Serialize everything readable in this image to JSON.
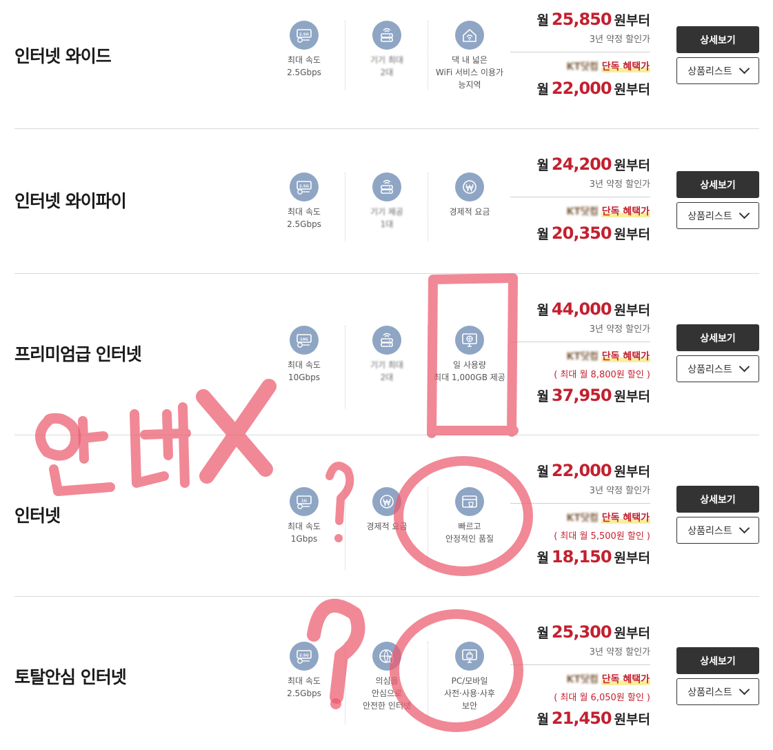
{
  "products": [
    {
      "title": "인터넷 와이드",
      "features": [
        {
          "icon": "speed-2.5g-icon",
          "label": "최대 속도\n2.5Gbps",
          "blur": false
        },
        {
          "icon": "router-icon",
          "label": "기기 최대\n2대",
          "blur": true
        },
        {
          "icon": "home-wifi-icon",
          "label": "댁 내 넓은\nWiFi 서비스 이용가\n능지역",
          "blur": false
        }
      ],
      "price_prefix": "월",
      "price": "25,850",
      "price_suffix": "원부터",
      "contract_note": "3년 약정 할인가",
      "exclusive_brand": "KT닷컴",
      "exclusive_label": "단독 혜택가",
      "discount_note": "",
      "exclusive_price": "22,000",
      "detail_button": "상세보기",
      "list_button": "상품리스트"
    },
    {
      "title": "인터넷 와이파이",
      "features": [
        {
          "icon": "speed-2.5g-icon",
          "label": "최대 속도\n2.5Gbps",
          "blur": false
        },
        {
          "icon": "router-icon",
          "label": "기기 제공\n1대",
          "blur": true
        },
        {
          "icon": "won-icon",
          "label": "경제적 요금",
          "blur": false
        }
      ],
      "price_prefix": "월",
      "price": "24,200",
      "price_suffix": "원부터",
      "contract_note": "3년 약정 할인가",
      "exclusive_brand": "KT닷컴",
      "exclusive_label": "단독 혜택가",
      "discount_note": "",
      "exclusive_price": "20,350",
      "detail_button": "상세보기",
      "list_button": "상품리스트"
    },
    {
      "title": "프리미엄급 인터넷",
      "features": [
        {
          "icon": "speed-10g-icon",
          "label": "최대 속도\n10Gbps",
          "blur": false
        },
        {
          "icon": "router-icon",
          "label": "기기 최대\n2대",
          "blur": true
        },
        {
          "icon": "globe-monitor-icon",
          "label": "일 사용량\n최대 1,000GB 제공",
          "blur": false
        }
      ],
      "price_prefix": "월",
      "price": "44,000",
      "price_suffix": "원부터",
      "contract_note": "3년 약정 할인가",
      "exclusive_brand": "KT닷컴",
      "exclusive_label": "단독 혜택가",
      "discount_note": "( 최대 월 8,800원 할인 )",
      "exclusive_price": "37,950",
      "detail_button": "상세보기",
      "list_button": "상품리스트"
    },
    {
      "title": "인터넷",
      "features": [
        {
          "icon": "speed-1g-icon",
          "label": "최대 속도\n1Gbps",
          "blur": false
        },
        {
          "icon": "won-icon",
          "label": "경제적 요금",
          "blur": false
        },
        {
          "icon": "card-bag-icon",
          "label": "빠르고\n안정적인 품질",
          "blur": false
        }
      ],
      "price_prefix": "월",
      "price": "22,000",
      "price_suffix": "원부터",
      "contract_note": "3년 약정 할인가",
      "exclusive_brand": "KT닷컴",
      "exclusive_label": "단독 혜택가",
      "discount_note": "( 최대 월 5,500원 할인 )",
      "exclusive_price": "18,150",
      "detail_button": "상세보기",
      "list_button": "상품리스트"
    },
    {
      "title": "토탈안심 인터넷",
      "features": [
        {
          "icon": "speed-2.5g-icon",
          "label": "최대 속도\n2.5Gbps",
          "blur": false
        },
        {
          "icon": "globe-shield-icon",
          "label": "의심을\n안심으로\n안전한 인터넷",
          "blur": false
        },
        {
          "icon": "pc-lock-icon",
          "label": "PC/모바일\n사전·사용·사후\n보안",
          "blur": false
        }
      ],
      "price_prefix": "월",
      "price": "25,300",
      "price_suffix": "원부터",
      "contract_note": "3년 약정 할인가",
      "exclusive_brand": "KT닷컴",
      "exclusive_label": "단독 혜택가",
      "discount_note": "( 최대 월 6,050원 할인 )",
      "exclusive_price": "21,450",
      "detail_button": "상세보기",
      "list_button": "상품리스트"
    }
  ],
  "annotations": {
    "handwriting_text": "안내X",
    "question_marks": [
      "?",
      "?"
    ],
    "color": "#ec5a6e"
  },
  "colors": {
    "accent_red": "#c3202f",
    "icon_circle": "#8fa5c4",
    "button_dark": "#333333",
    "highlight_yellow": "#f8ee9c"
  }
}
